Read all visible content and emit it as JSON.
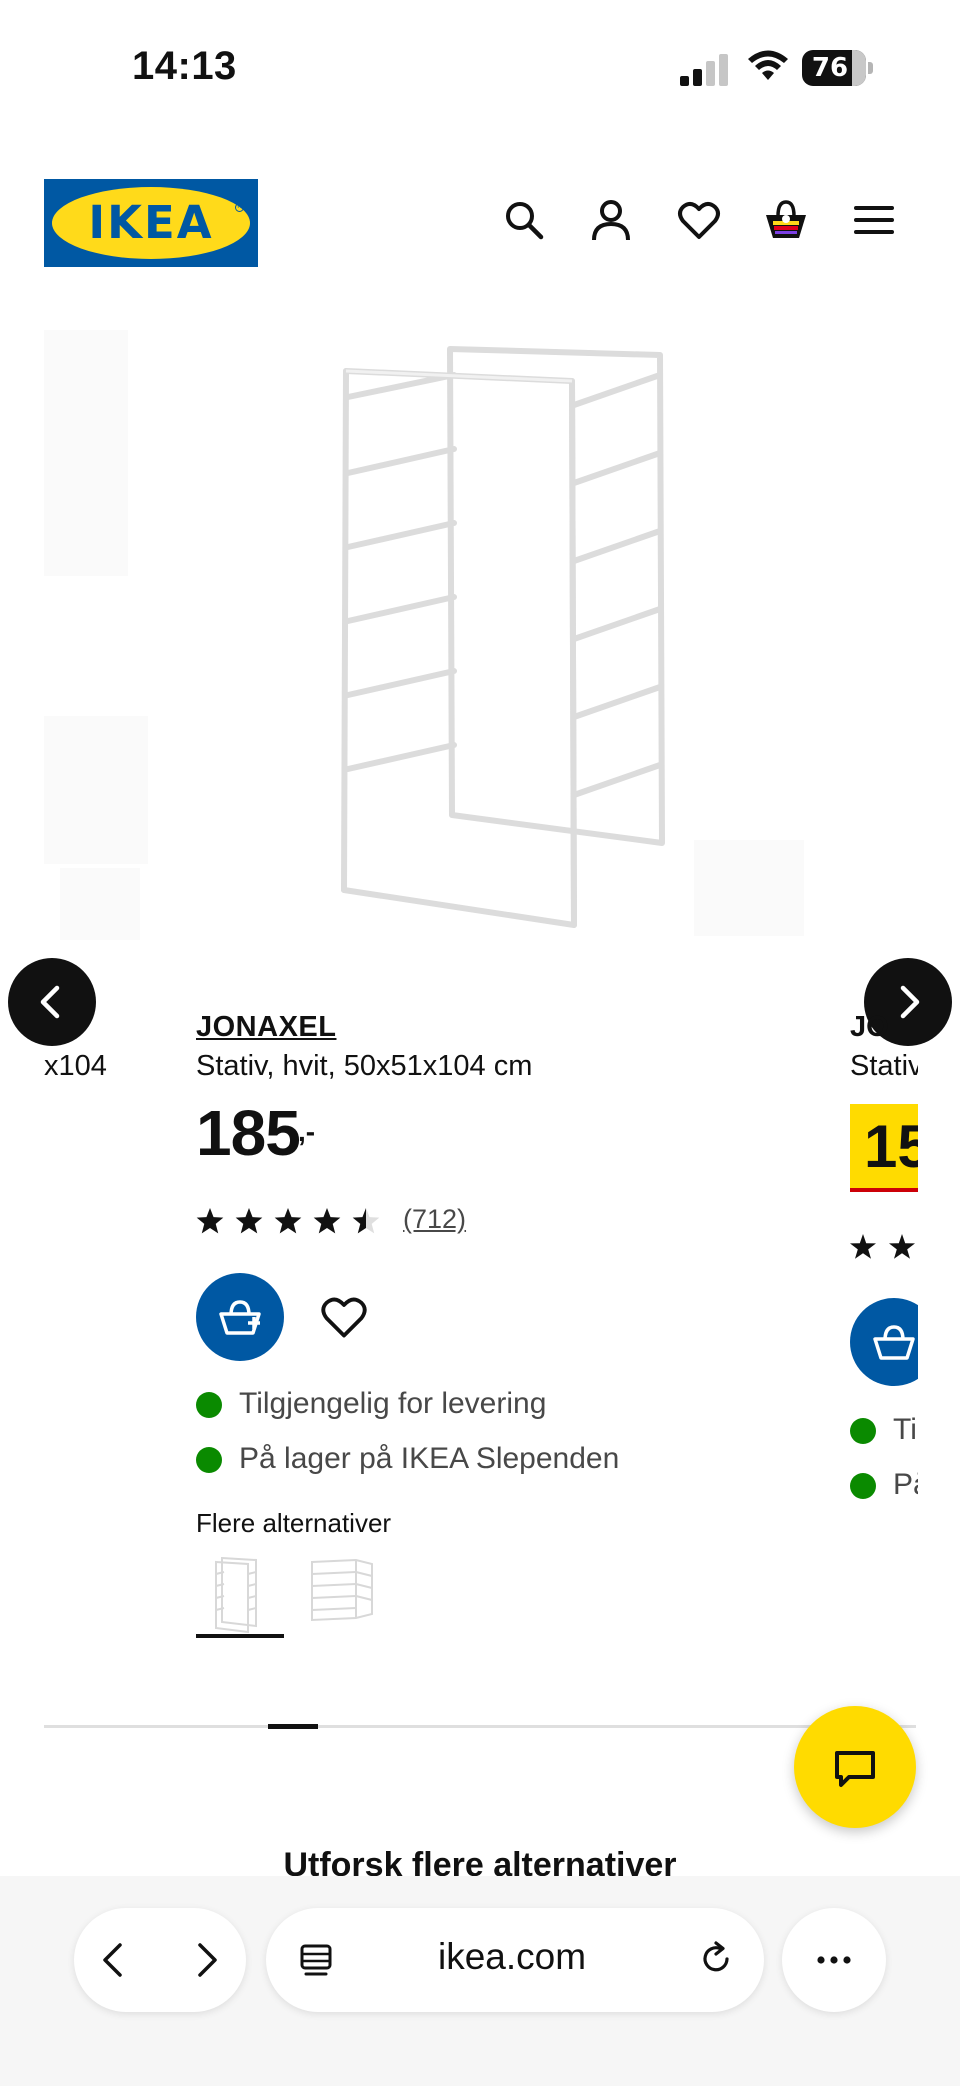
{
  "status_bar": {
    "time": "14:13",
    "battery": "76",
    "icons": [
      "signal-icon",
      "wifi-icon",
      "battery-icon"
    ]
  },
  "header": {
    "logo_text": "IKEA",
    "logo_colors": {
      "blue": "#0058a3",
      "yellow": "#ffda1a"
    },
    "icons": [
      "search-icon",
      "account-icon",
      "heart-icon",
      "shopping-bag-icon",
      "menu-icon"
    ]
  },
  "carousel": {
    "prev_fragment": "x104",
    "current": {
      "name": "JONAXEL",
      "description": "Stativ, hvit, 50x51x104 cm",
      "price": "185",
      "price_suffix": ",-",
      "rating": 4.5,
      "rating_max": 5,
      "review_count": "(712)",
      "availability": [
        "Tilgjengelig for levering",
        "På lager på IKEA Slependen"
      ],
      "alternatives_label": "Flere alternativer",
      "alternatives_selected_index": 0,
      "alternatives_count": 2
    },
    "next_peek": {
      "name": "JO",
      "description": "Stativ",
      "price": "15",
      "price_highlight_color": "#ffdb00",
      "availability": [
        "Ti",
        "På"
      ]
    }
  },
  "scroll_position": {
    "active_index": 3,
    "total": 12
  },
  "section_heading": "Utforsk flere alternativer",
  "browser": {
    "url": "ikea.com",
    "icons": [
      "back-icon",
      "forward-icon",
      "tabs-icon",
      "reload-icon",
      "more-icon"
    ]
  },
  "colors": {
    "accent_blue": "#0058a3",
    "stock_green": "#0a8a00",
    "chat_yellow": "#ffdb00",
    "price_underline_red": "#cc0008"
  }
}
